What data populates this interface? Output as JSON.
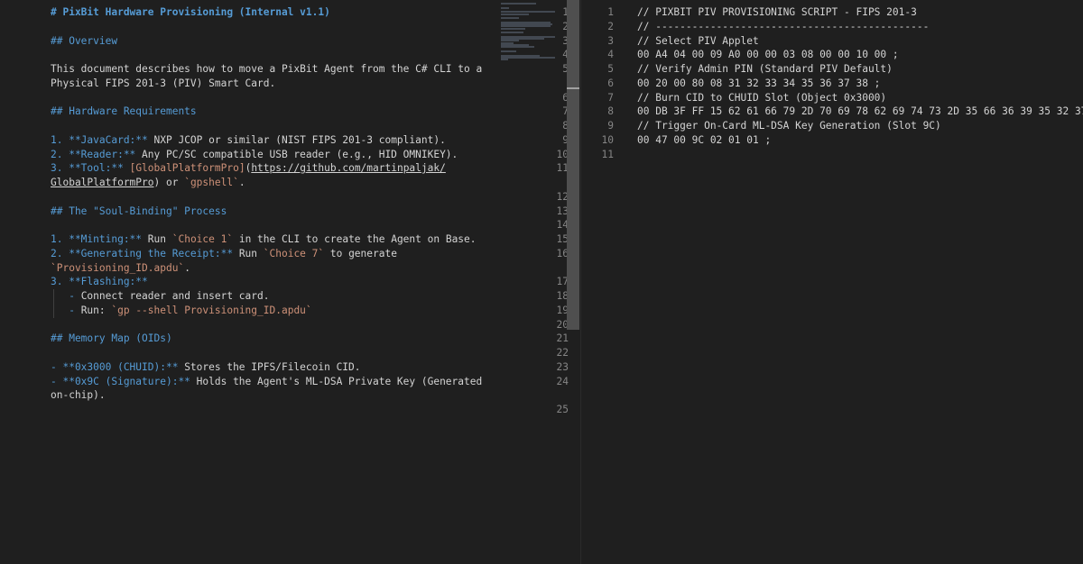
{
  "left_editor": {
    "lines": [
      {
        "n": "1",
        "segments": [
          {
            "c": "h",
            "t": "# PixBit Hardware Provisioning (Internal v1.1)"
          }
        ]
      },
      {
        "n": "2",
        "segments": []
      },
      {
        "n": "3",
        "segments": [
          {
            "c": "hh",
            "t": "## Overview"
          }
        ]
      },
      {
        "n": "4",
        "segments": []
      },
      {
        "n": "5",
        "segments": [
          {
            "c": "t",
            "t": "This document describes how to move a PixBit Agent from the C# CLI to a"
          }
        ]
      },
      {
        "n": "",
        "segments": [
          {
            "c": "t",
            "t": "Physical FIPS 201-3 (PIV) Smart Card."
          }
        ]
      },
      {
        "n": "6",
        "segments": []
      },
      {
        "n": "7",
        "segments": [
          {
            "c": "hh",
            "t": "## Hardware Requirements"
          }
        ]
      },
      {
        "n": "8",
        "segments": []
      },
      {
        "n": "9",
        "segments": [
          {
            "c": "b",
            "t": "1. **JavaCard:**"
          },
          {
            "c": "t",
            "t": " NXP JCOP or similar (NIST FIPS 201-3 compliant)."
          }
        ]
      },
      {
        "n": "10",
        "segments": [
          {
            "c": "b",
            "t": "2. **Reader:**"
          },
          {
            "c": "t",
            "t": " Any PC/SC compatible USB reader (e.g., HID OMNIKEY)."
          }
        ]
      },
      {
        "n": "11",
        "segments": [
          {
            "c": "b",
            "t": "3. **Tool:**"
          },
          {
            "c": "t",
            "t": " "
          },
          {
            "c": "lnk",
            "t": "[GlobalPlatformPro]"
          },
          {
            "c": "t",
            "t": "("
          },
          {
            "c": "url",
            "t": "https://github.com/martinpaljak/"
          }
        ]
      },
      {
        "n": "",
        "segments": [
          {
            "c": "url",
            "t": "GlobalPlatformPro"
          },
          {
            "c": "t",
            "t": ") or "
          },
          {
            "c": "c",
            "t": "`gpshell`"
          },
          {
            "c": "t",
            "t": "."
          }
        ]
      },
      {
        "n": "12",
        "segments": []
      },
      {
        "n": "13",
        "segments": [
          {
            "c": "hh",
            "t": "## The \"Soul-Binding\" Process"
          }
        ]
      },
      {
        "n": "14",
        "segments": []
      },
      {
        "n": "15",
        "segments": [
          {
            "c": "b",
            "t": "1. **Minting:**"
          },
          {
            "c": "t",
            "t": " Run "
          },
          {
            "c": "c",
            "t": "`Choice 1`"
          },
          {
            "c": "t",
            "t": " in the CLI to create the Agent on Base."
          }
        ]
      },
      {
        "n": "16",
        "segments": [
          {
            "c": "b",
            "t": "2. **Generating the Receipt:**"
          },
          {
            "c": "t",
            "t": " Run "
          },
          {
            "c": "c",
            "t": "`Choice 7`"
          },
          {
            "c": "t",
            "t": " to generate"
          }
        ]
      },
      {
        "n": "",
        "segments": [
          {
            "c": "c",
            "t": "`Provisioning_ID.apdu`"
          },
          {
            "c": "t",
            "t": "."
          }
        ]
      },
      {
        "n": "17",
        "segments": [
          {
            "c": "b",
            "t": "3. **Flashing:**"
          }
        ]
      },
      {
        "n": "18",
        "segments": [
          {
            "c": "b",
            "t": "   - "
          },
          {
            "c": "t",
            "t": "Connect reader and insert card."
          }
        ],
        "guide": true
      },
      {
        "n": "19",
        "segments": [
          {
            "c": "b",
            "t": "   - "
          },
          {
            "c": "t",
            "t": "Run: "
          },
          {
            "c": "c",
            "t": "`gp --shell Provisioning_ID.apdu`"
          }
        ],
        "guide": true
      },
      {
        "n": "20",
        "segments": []
      },
      {
        "n": "21",
        "segments": [
          {
            "c": "hh",
            "t": "## Memory Map (OIDs)"
          }
        ]
      },
      {
        "n": "22",
        "segments": []
      },
      {
        "n": "23",
        "segments": [
          {
            "c": "b",
            "t": "- **0x3000 (CHUID):**"
          },
          {
            "c": "t",
            "t": " Stores the IPFS/Filecoin CID."
          }
        ]
      },
      {
        "n": "24",
        "segments": [
          {
            "c": "b",
            "t": "- **0x9C (Signature):**"
          },
          {
            "c": "t",
            "t": " Holds the Agent's ML-DSA Private Key (Generated"
          }
        ]
      },
      {
        "n": "",
        "segments": [
          {
            "c": "t",
            "t": "on-chip)."
          }
        ]
      },
      {
        "n": "25",
        "segments": []
      }
    ]
  },
  "right_editor": {
    "lines": [
      {
        "n": "1",
        "segments": [
          {
            "c": "cm",
            "t": "// PIXBIT PIV PROVISIONING SCRIPT - FIPS 201-3"
          }
        ]
      },
      {
        "n": "2",
        "segments": [
          {
            "c": "cm",
            "t": "// ---------------------------------------------"
          }
        ]
      },
      {
        "n": "3",
        "segments": [
          {
            "c": "cm",
            "t": "// Select PIV Applet"
          }
        ]
      },
      {
        "n": "4",
        "segments": [
          {
            "c": "t",
            "t": "00 A4 04 00 09 A0 00 00 03 08 00 00 10 00 ;"
          }
        ]
      },
      {
        "n": "5",
        "segments": [
          {
            "c": "cm",
            "t": "// Verify Admin PIN (Standard PIV Default)"
          }
        ]
      },
      {
        "n": "6",
        "segments": [
          {
            "c": "t",
            "t": "00 20 00 80 08 31 32 33 34 35 36 37 38 ;"
          }
        ]
      },
      {
        "n": "7",
        "segments": [
          {
            "c": "cm",
            "t": "// Burn CID to CHUID Slot (Object 0x3000)"
          }
        ]
      },
      {
        "n": "8",
        "segments": [
          {
            "c": "t",
            "t": "00 DB 3F FF 15 62 61 66 79 2D 70 69 78 62 69 74 73 2D 35 66 36 39 35 32 37"
          }
        ]
      },
      {
        "n": "9",
        "segments": [
          {
            "c": "cm",
            "t": "// Trigger On-Card ML-DSA Key Generation (Slot 9C)"
          }
        ]
      },
      {
        "n": "10",
        "segments": [
          {
            "c": "t",
            "t": "00 47 00 9C 02 01 01 ;"
          }
        ]
      },
      {
        "n": "11",
        "segments": []
      }
    ]
  },
  "colors": {
    "background": "#1f1f1f",
    "heading": "#569cd6",
    "string": "#ce9178",
    "text": "#d4d4d4",
    "line_number": "#858585"
  }
}
